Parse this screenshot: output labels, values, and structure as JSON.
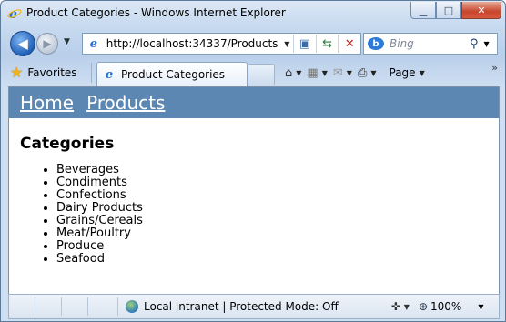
{
  "window": {
    "title": "Product Categories - Windows Internet Explorer"
  },
  "caption_buttons": {
    "minimize": "▁",
    "maximize": "□",
    "close": "✕"
  },
  "address_bar": {
    "url": "http://localhost:34337/Products"
  },
  "search": {
    "placeholder": "Bing"
  },
  "command_bar": {
    "favorites_label": "Favorites",
    "tab_label": "Product Categories",
    "page_label": "Page"
  },
  "site_nav": {
    "home": "Home",
    "products": "Products"
  },
  "main": {
    "heading": "Categories",
    "categories": [
      "Beverages",
      "Condiments",
      "Confections",
      "Dairy Products",
      "Grains/Cereals",
      "Meat/Poultry",
      "Produce",
      "Seafood"
    ]
  },
  "status_bar": {
    "zone_text": "Local intranet | Protected Mode: Off",
    "zoom_text": "100%"
  },
  "colors": {
    "site_header_bg": "#5c87b2",
    "chrome_bg": "#c6d9ef",
    "close_button": "#c7452c"
  },
  "icons": [
    "ie-logo-icon",
    "back-arrow-icon",
    "forward-arrow-icon",
    "compatibility-view-icon",
    "refresh-icon",
    "stop-icon",
    "bing-icon",
    "search-icon",
    "favorites-star-icon",
    "home-icon",
    "rss-feed-icon",
    "read-mail-icon",
    "print-icon",
    "globe-icon",
    "zoom-icon"
  ]
}
